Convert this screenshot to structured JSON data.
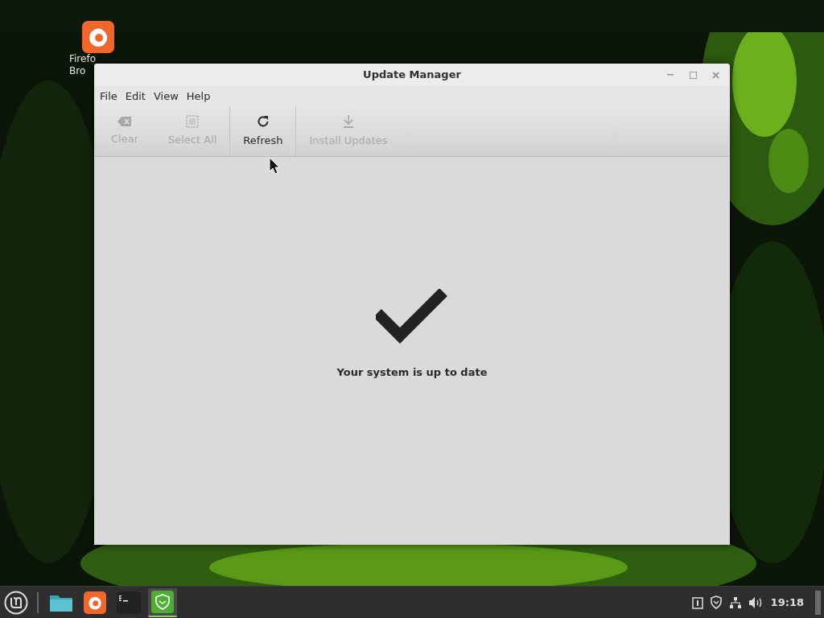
{
  "desktop_icons": [
    {
      "label_lines": [
        "Firefo",
        "Bro"
      ]
    }
  ],
  "window": {
    "title": "Update Manager",
    "menu": [
      "File",
      "Edit",
      "View",
      "Help"
    ],
    "toolbar": [
      {
        "kind": "clear",
        "label": "Clear",
        "disabled": true
      },
      {
        "kind": "select_all",
        "label": "Select All",
        "disabled": true
      },
      {
        "kind": "refresh",
        "label": "Refresh",
        "disabled": false
      },
      {
        "kind": "install",
        "label": "Install Updates",
        "disabled": true
      }
    ],
    "status_message": "Your system is up to date"
  },
  "taskbar": {
    "apps": [
      {
        "kind": "files",
        "active": false
      },
      {
        "kind": "firefox",
        "active": false
      },
      {
        "kind": "terminal",
        "active": false
      },
      {
        "kind": "update_manager",
        "active": true
      }
    ],
    "clock": "19:18"
  }
}
